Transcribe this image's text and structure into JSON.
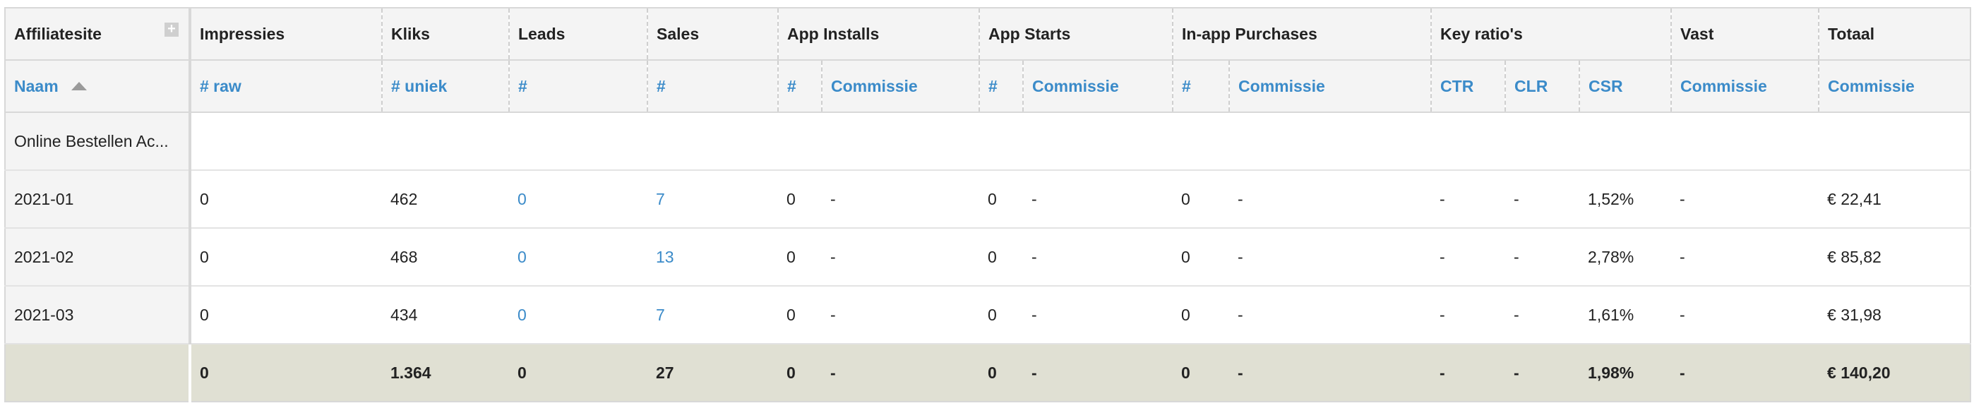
{
  "groups": {
    "affiliatesite": "Affiliatesite",
    "impressies": "Impressies",
    "kliks": "Kliks",
    "leads": "Leads",
    "sales": "Sales",
    "app_installs": "App Installs",
    "app_starts": "App Starts",
    "in_app_purchases": "In-app Purchases",
    "key_ratios": "Key ratio's",
    "vast": "Vast",
    "totaal": "Totaal"
  },
  "subheaders": {
    "naam": "Naam",
    "raw": "# raw",
    "uniek": "# uniek",
    "leads_count": "#",
    "sales_count": "#",
    "installs_count": "#",
    "installs_commissie": "Commissie",
    "starts_count": "#",
    "starts_commissie": "Commissie",
    "purchases_count": "#",
    "purchases_commissie": "Commissie",
    "ctr": "CTR",
    "clr": "CLR",
    "csr": "CSR",
    "vast_commissie": "Commissie",
    "totaal_commissie": "Commissie"
  },
  "site": {
    "name": "Online Bestellen Ac..."
  },
  "rows": [
    {
      "period": "2021-01",
      "impressies": "0",
      "kliks": "462",
      "leads": "0",
      "sales": "7",
      "installs": "0",
      "installs_comm": "-",
      "starts": "0",
      "starts_comm": "-",
      "purchases": "0",
      "purchases_comm": "-",
      "ctr": "-",
      "clr": "-",
      "csr": "1,52%",
      "vast": "-",
      "totaal": "€ 22,41"
    },
    {
      "period": "2021-02",
      "impressies": "0",
      "kliks": "468",
      "leads": "0",
      "sales": "13",
      "installs": "0",
      "installs_comm": "-",
      "starts": "0",
      "starts_comm": "-",
      "purchases": "0",
      "purchases_comm": "-",
      "ctr": "-",
      "clr": "-",
      "csr": "2,78%",
      "vast": "-",
      "totaal": "€ 85,82"
    },
    {
      "period": "2021-03",
      "impressies": "0",
      "kliks": "434",
      "leads": "0",
      "sales": "7",
      "installs": "0",
      "installs_comm": "-",
      "starts": "0",
      "starts_comm": "-",
      "purchases": "0",
      "purchases_comm": "-",
      "ctr": "-",
      "clr": "-",
      "csr": "1,61%",
      "vast": "-",
      "totaal": "€ 31,98"
    }
  ],
  "total": {
    "impressies": "0",
    "kliks": "1.364",
    "leads": "0",
    "sales": "27",
    "installs": "0",
    "installs_comm": "-",
    "starts": "0",
    "starts_comm": "-",
    "purchases": "0",
    "purchases_comm": "-",
    "ctr": "-",
    "clr": "-",
    "csr": "1,98%",
    "vast": "-",
    "totaal": "€ 140,20"
  },
  "colors": {
    "link": "#3b8bc9",
    "header_bg": "#f4f4f4",
    "total_bg": "#e0e0d3"
  },
  "icons": {
    "expand": "plus-icon",
    "sort": "sort-ascending-icon"
  }
}
